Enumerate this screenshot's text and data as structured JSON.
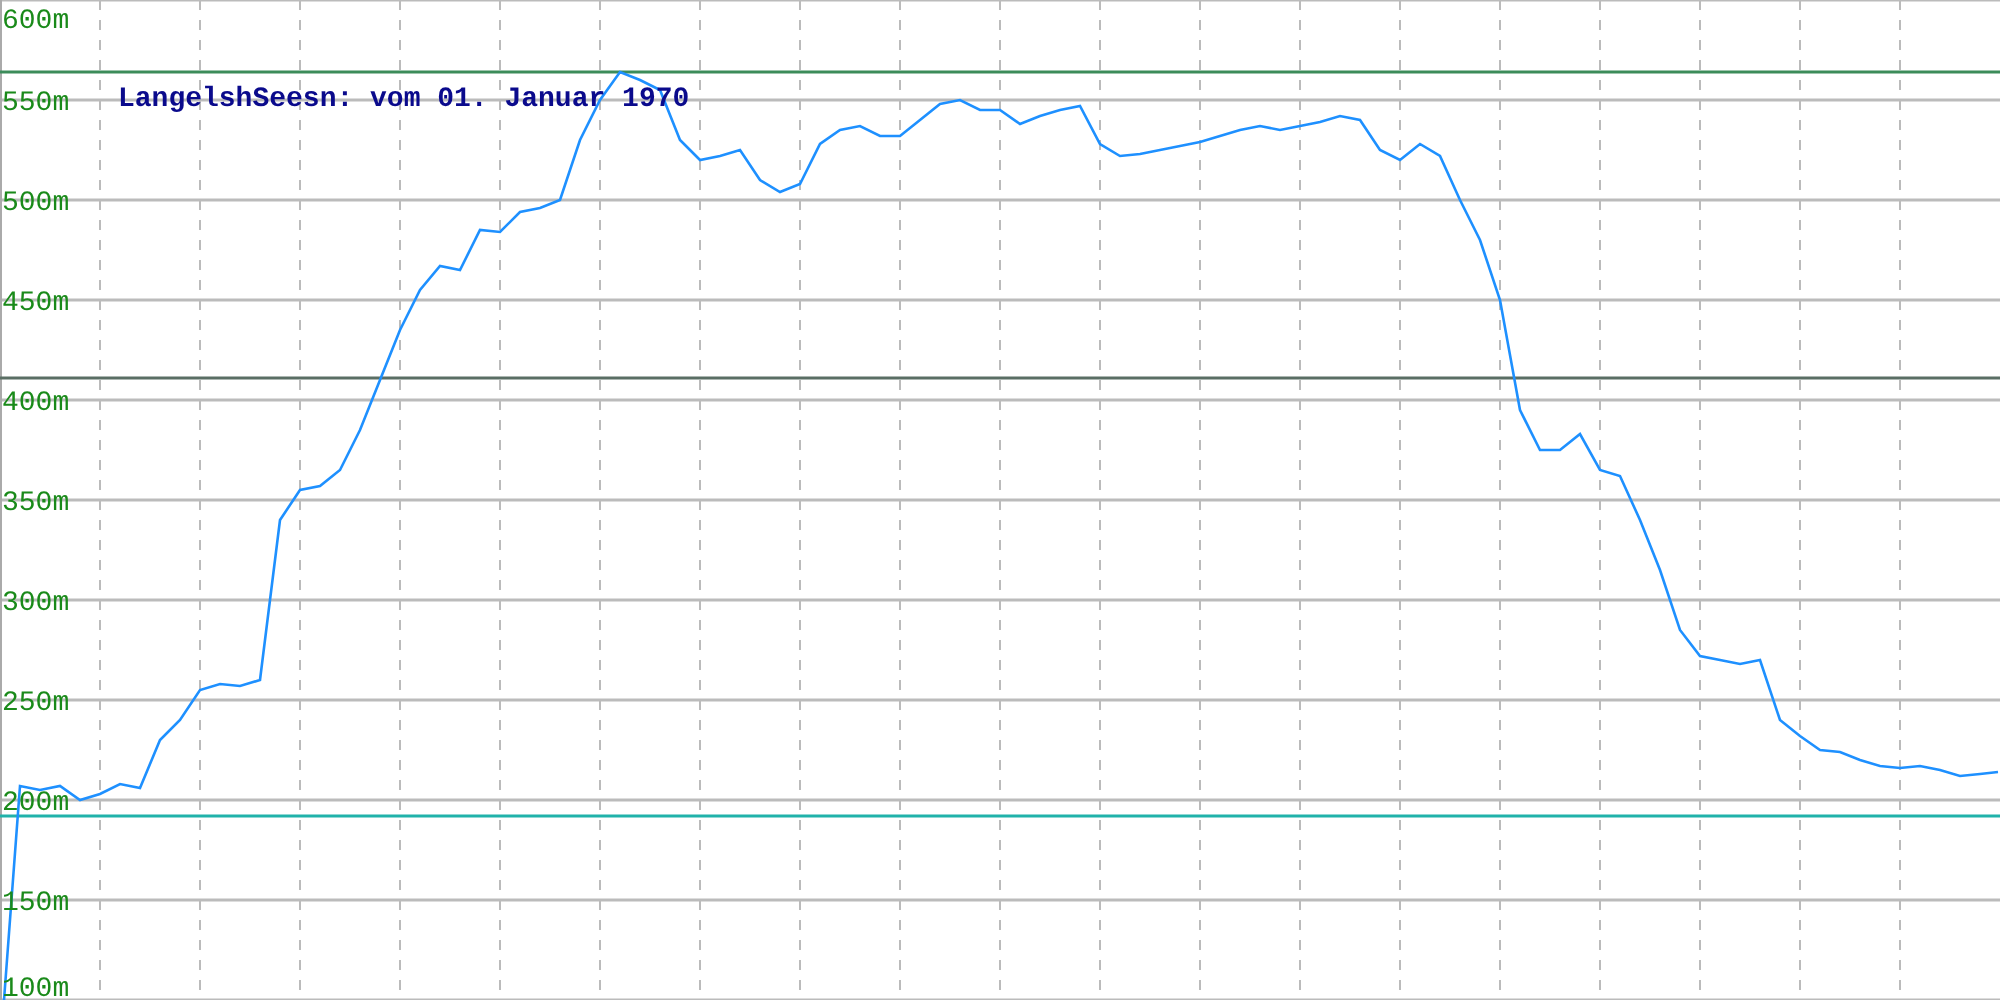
{
  "chart_data": {
    "type": "line",
    "title": "LangelshSeesn: vom 01. Januar 1970",
    "ylim": [
      100,
      600
    ],
    "yticks": [
      {
        "value": 100,
        "label": "100m"
      },
      {
        "value": 150,
        "label": "150m"
      },
      {
        "value": 200,
        "label": "200m"
      },
      {
        "value": 250,
        "label": "250m"
      },
      {
        "value": 300,
        "label": "300m"
      },
      {
        "value": 350,
        "label": "350m"
      },
      {
        "value": 400,
        "label": "400m"
      },
      {
        "value": 450,
        "label": "450m"
      },
      {
        "value": 500,
        "label": "500m"
      },
      {
        "value": 550,
        "label": "550m"
      },
      {
        "value": 600,
        "label": "600m"
      }
    ],
    "grid": true,
    "series": [
      {
        "color": "#1e90ff",
        "values": [
          100,
          207,
          205,
          207,
          200,
          203,
          208,
          206,
          230,
          240,
          255,
          258,
          257,
          260,
          340,
          355,
          357,
          365,
          385,
          410,
          435,
          455,
          467,
          465,
          485,
          484,
          494,
          496,
          500,
          530,
          550,
          564,
          560,
          555,
          530,
          520,
          522,
          525,
          510,
          504,
          508,
          528,
          535,
          537,
          532,
          532,
          540,
          548,
          550,
          545,
          545,
          538,
          542,
          545,
          547,
          528,
          522,
          523,
          525,
          527,
          529,
          532,
          535,
          537,
          535,
          537,
          539,
          542,
          540,
          525,
          520,
          528,
          522,
          500,
          480,
          450,
          395,
          375,
          375,
          383,
          365,
          362,
          340,
          315,
          285,
          272,
          270,
          268,
          270,
          240,
          232,
          225,
          224,
          220,
          217,
          216,
          217,
          215,
          212,
          213,
          214
        ]
      }
    ],
    "ref_lines": [
      {
        "axis": "y",
        "value": 564,
        "color": "#3c8c5a"
      },
      {
        "axis": "y",
        "value": 411,
        "color": "#5a6e64"
      },
      {
        "axis": "y",
        "value": 192,
        "color": "#20b2aa"
      }
    ]
  }
}
